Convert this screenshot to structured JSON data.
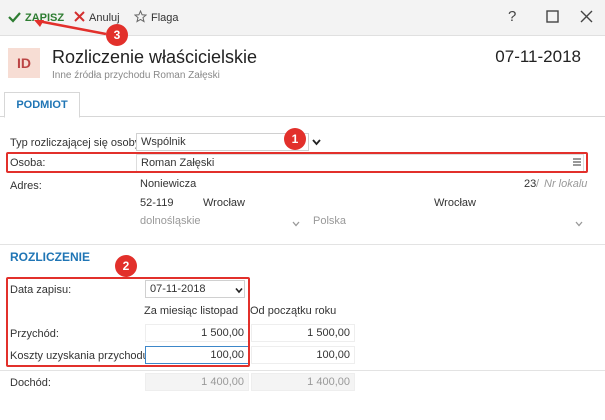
{
  "toolbar": {
    "save_label": "ZAPISZ",
    "cancel_label": "Anuluj",
    "flag_label": "Flaga",
    "help_label": "?"
  },
  "document": {
    "id_badge": "ID",
    "title": "Rozliczenie właścicielskie",
    "subtitle": "Inne źródła przychodu Roman Załęski",
    "date": "07-11-2018"
  },
  "tabs": [
    {
      "label": "PODMIOT"
    }
  ],
  "podmiot": {
    "type_label": "Typ rozliczającej się osoby:",
    "type_value": "Wspólnik",
    "person_label": "Osoba:",
    "person_value": "Roman Załęski",
    "address_label": "Adres:",
    "street": "Noniewicza",
    "house_number": "23",
    "apartment_placeholder": "Nr lokalu",
    "postcode": "52-119",
    "city": "Wrocław",
    "post_city": "Wrocław",
    "region": "dolnośląskie",
    "country": "Polska"
  },
  "rozliczenie": {
    "section_title": "ROZLICZENIE",
    "date_label": "Data zapisu:",
    "date_value": "07-11-2018",
    "col_month": "Za miesiąc listopad",
    "col_year": "Od początku roku",
    "income_label": "Przychód:",
    "income_month": "1 500,00",
    "income_year": "1 500,00",
    "cost_label": "Koszty uzyskania przychodu:",
    "cost_month": "100,00",
    "cost_year": "100,00",
    "profit_label": "Dochód:",
    "profit_month": "1 400,00",
    "profit_year": "1 400,00"
  },
  "annotations": {
    "badge1": "1",
    "badge2": "2",
    "badge3": "3"
  },
  "colors": {
    "accent": "#1f75b5",
    "annotation": "#e2302b",
    "save": "#2e7d32"
  },
  "icons": [
    "check-icon",
    "x-icon",
    "star-icon",
    "help-icon",
    "maximize-icon",
    "close-icon",
    "chevron-down-icon",
    "list-icon"
  ]
}
